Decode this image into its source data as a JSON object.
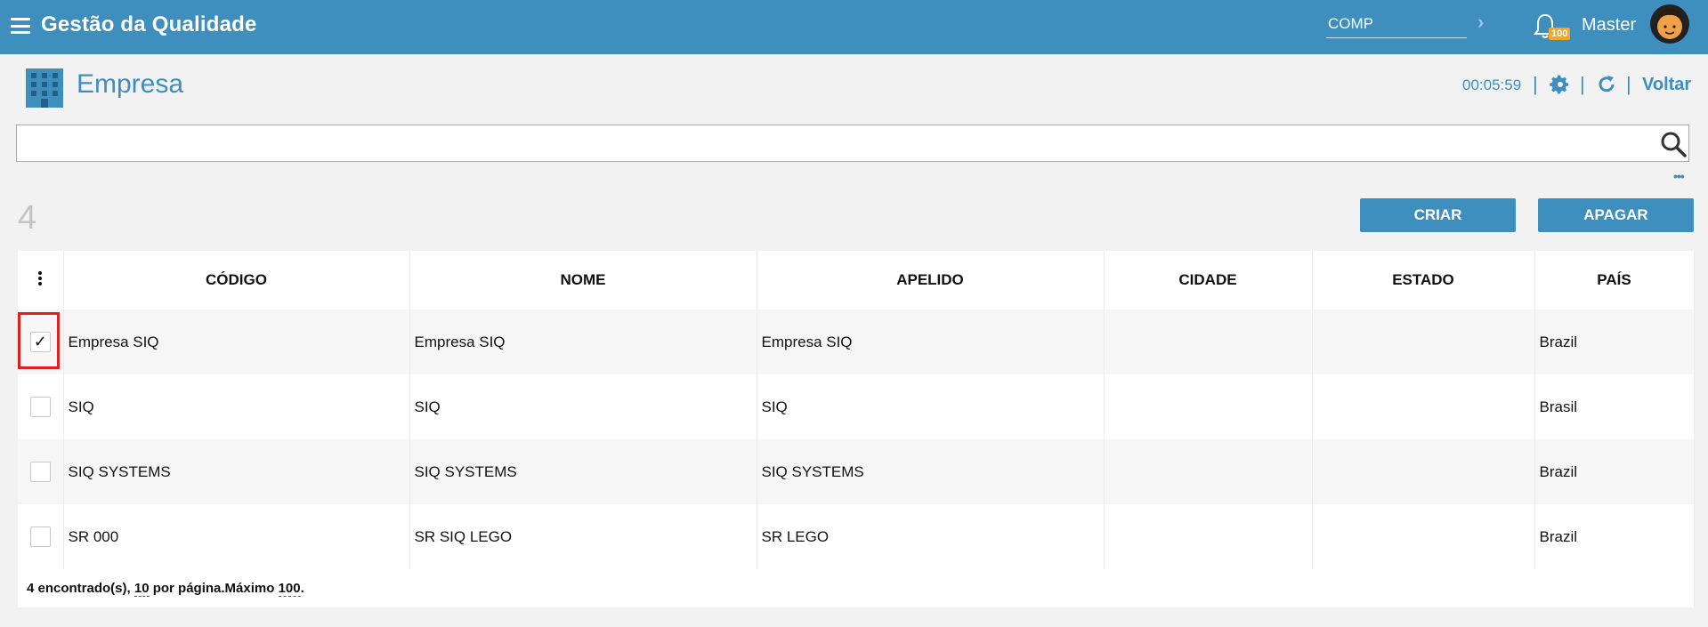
{
  "header": {
    "app_title": "Gestão da Qualidade",
    "company_value": "COMP",
    "notification_count": "100",
    "user_name": "Master"
  },
  "page": {
    "title": "Empresa",
    "timer": "00:05:59",
    "back_label": "Voltar"
  },
  "search": {
    "value": "",
    "more_label": "•••"
  },
  "toolbar": {
    "count": "4",
    "create_label": "CRIAR",
    "delete_label": "APAGAR"
  },
  "table": {
    "columns": [
      "CÓDIGO",
      "NOME",
      "APELIDO",
      "CIDADE",
      "ESTADO",
      "PAÍS"
    ],
    "rows": [
      {
        "codigo": "Empresa SIQ",
        "nome": "Empresa SIQ",
        "apelido": "Empresa SIQ",
        "cidade": "",
        "estado": "",
        "pais": "Brazil",
        "checked": true,
        "check_mark": "✓"
      },
      {
        "codigo": "SIQ",
        "nome": "SIQ",
        "apelido": "SIQ",
        "cidade": "",
        "estado": "",
        "pais": "Brasil",
        "checked": false,
        "check_mark": ""
      },
      {
        "codigo": "SIQ SYSTEMS",
        "nome": "SIQ SYSTEMS",
        "apelido": "SIQ SYSTEMS",
        "cidade": "",
        "estado": "",
        "pais": "Brazil",
        "checked": false,
        "check_mark": ""
      },
      {
        "codigo": "SR 000",
        "nome": "SR SIQ LEGO",
        "apelido": "SR LEGO",
        "cidade": "",
        "estado": "",
        "pais": "Brazil",
        "checked": false,
        "check_mark": ""
      }
    ],
    "footer": {
      "found": "4 encontrado(s), ",
      "per_page_value": "10",
      "per_page_text": " por página.Máximo ",
      "max_value": "100",
      "end": "."
    }
  },
  "colors": {
    "primary": "#3e8ebe",
    "badge": "#f5a623",
    "highlight": "#e02020"
  },
  "icons": [
    "menu-icon",
    "chevron-right-icon",
    "bell-icon",
    "avatar",
    "building-icon",
    "gear-icon",
    "refresh-icon",
    "search-icon",
    "kebab-icon",
    "check-icon"
  ]
}
